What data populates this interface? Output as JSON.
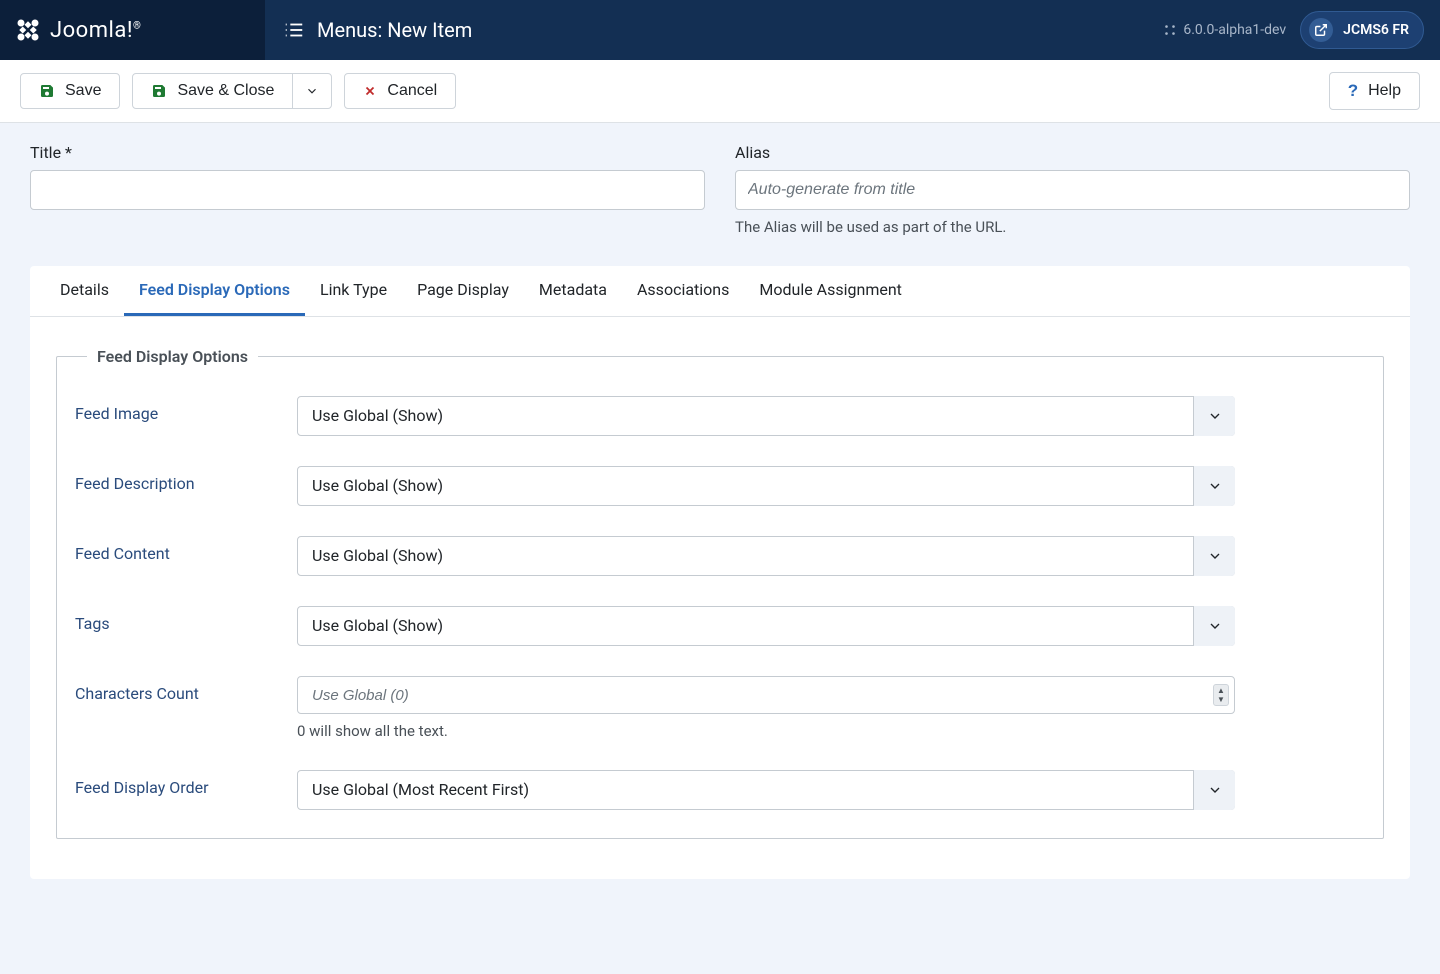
{
  "brand": "Joomla!",
  "page_title": "Menus: New Item",
  "version": "6.0.0-alpha1-dev",
  "site_button": "JCMS6 FR",
  "toolbar": {
    "save": "Save",
    "save_close": "Save & Close",
    "cancel": "Cancel",
    "help": "Help"
  },
  "title_field": {
    "label": "Title *",
    "value": ""
  },
  "alias_field": {
    "label": "Alias",
    "placeholder": "Auto-generate from title",
    "help": "The Alias will be used as part of the URL."
  },
  "tabs": {
    "details": "Details",
    "feed_display": "Feed Display Options",
    "link_type": "Link Type",
    "page_display": "Page Display",
    "metadata": "Metadata",
    "associations": "Associations",
    "module_assignment": "Module Assignment"
  },
  "fieldset_title": "Feed Display Options",
  "fields": {
    "feed_image": {
      "label": "Feed Image",
      "value": "Use Global (Show)"
    },
    "feed_description": {
      "label": "Feed Description",
      "value": "Use Global (Show)"
    },
    "feed_content": {
      "label": "Feed Content",
      "value": "Use Global (Show)"
    },
    "tags": {
      "label": "Tags",
      "value": "Use Global (Show)"
    },
    "chars_count": {
      "label": "Characters Count",
      "placeholder": "Use Global (0)",
      "help": "0 will show all the text."
    },
    "feed_display_order": {
      "label": "Feed Display Order",
      "value": "Use Global (Most Recent First)"
    }
  }
}
